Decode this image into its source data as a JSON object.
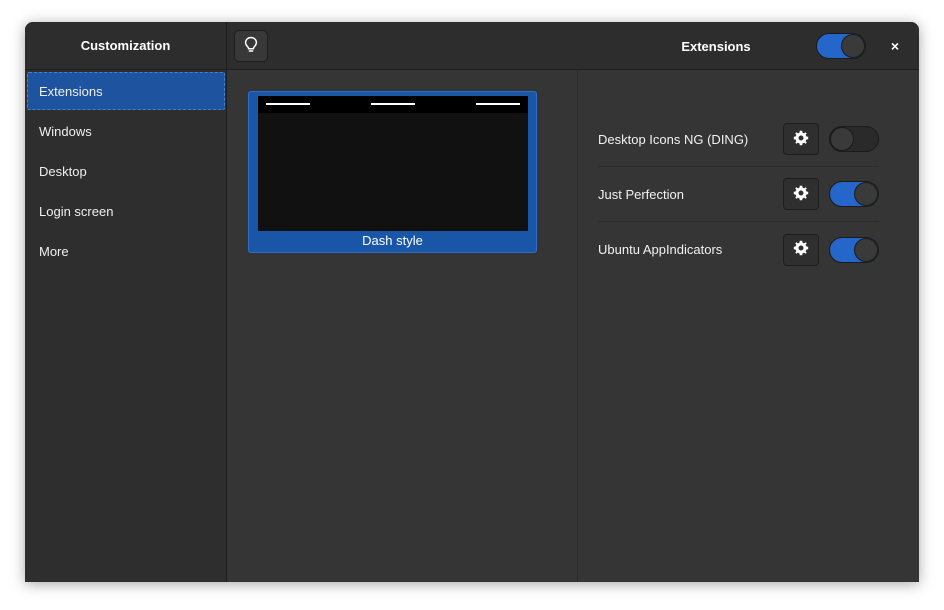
{
  "sidebar": {
    "title": "Customization",
    "items": [
      {
        "label": "Extensions",
        "selected": true
      },
      {
        "label": "Windows",
        "selected": false
      },
      {
        "label": "Desktop",
        "selected": false
      },
      {
        "label": "Login screen",
        "selected": false
      },
      {
        "label": "More",
        "selected": false
      }
    ]
  },
  "header": {
    "title": "Extensions",
    "tip_icon": "lightbulb-icon",
    "master_switch_on": true,
    "close_label": "×"
  },
  "preview": {
    "label": "Dash style",
    "selected": true
  },
  "extensions": [
    {
      "name": "Desktop Icons NG (DING)",
      "enabled": false,
      "settings_icon": "gear-icon"
    },
    {
      "name": "Just Perfection",
      "enabled": true,
      "settings_icon": "gear-icon"
    },
    {
      "name": "Ubuntu AppIndicators",
      "enabled": true,
      "settings_icon": "gear-icon"
    }
  ],
  "colors": {
    "accent": "#2466c9",
    "selected_bg": "#1e53a0",
    "window_bg": "#353535",
    "sidebar_bg": "#2e2e2e"
  }
}
